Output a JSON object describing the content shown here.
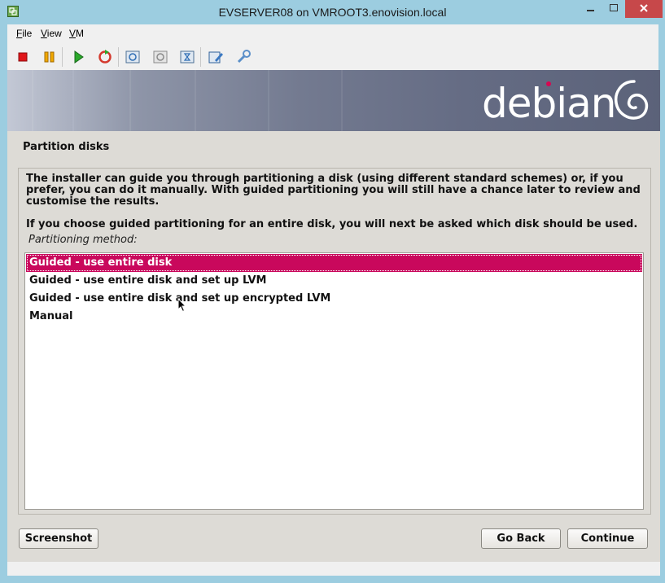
{
  "window": {
    "title": "EVSERVER08 on VMROOT3.enovision.local",
    "chrome_color": "#9ccde0",
    "close_color": "#c7484a"
  },
  "menubar": {
    "items": [
      {
        "label": "File",
        "accel": "F",
        "rest": "ile"
      },
      {
        "label": "View",
        "accel": "V",
        "rest": "iew"
      },
      {
        "label": "VM",
        "accel": "V",
        "rest": "M"
      }
    ]
  },
  "toolbar": {
    "buttons": [
      {
        "icon": "stop-icon",
        "color": "#e0161a"
      },
      {
        "icon": "pause-icon",
        "color": "#f0a800"
      },
      {
        "icon": "play-icon",
        "color": "#2aa82a"
      },
      {
        "icon": "reset-icon",
        "color": "#d43a2e"
      },
      {
        "icon": "snapshot-icon"
      },
      {
        "icon": "revert-snapshot-icon"
      },
      {
        "icon": "manage-snapshots-icon"
      },
      {
        "icon": "edit-settings-icon"
      },
      {
        "icon": "vm-tools-icon"
      }
    ]
  },
  "guest": {
    "brand": "debian",
    "brand_color": "#d70751",
    "page_title": "Partition disks",
    "description_1": "The installer can guide you through partitioning a disk (using different standard schemes) or, if you prefer, you can do it manually. With guided partitioning you will still have a chance later to review and customise the results.",
    "description_2": "If you choose guided partitioning for an entire disk, you will next be asked which disk should be used.",
    "method_label": "Partitioning method:",
    "options": [
      "Guided - use entire disk",
      "Guided - use entire disk and set up LVM",
      "Guided - use entire disk and set up encrypted LVM",
      "Manual"
    ],
    "selected_option": "Guided - use entire disk",
    "selection_color": "#c9085c",
    "buttons": {
      "screenshot": "Screenshot",
      "go_back": "Go Back",
      "continue": "Continue"
    }
  }
}
